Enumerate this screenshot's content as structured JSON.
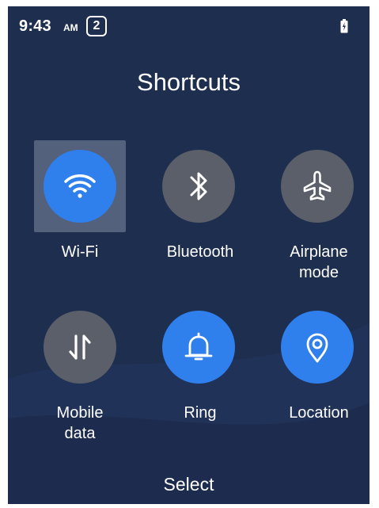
{
  "status_bar": {
    "time": "9:43",
    "ampm": "AM",
    "notification_count": "2",
    "battery_icon": "battery-charging-icon"
  },
  "screen": {
    "title": "Shortcuts"
  },
  "shortcuts": [
    {
      "label": "Wi-Fi",
      "icon": "wifi-icon",
      "state": "on",
      "focused": true
    },
    {
      "label": "Bluetooth",
      "icon": "bluetooth-icon",
      "state": "off",
      "focused": false
    },
    {
      "label": "Airplane\nmode",
      "icon": "airplane-icon",
      "state": "off",
      "focused": false
    },
    {
      "label": "Mobile\ndata",
      "icon": "mobile-data-icon",
      "state": "off",
      "focused": false
    },
    {
      "label": "Ring",
      "icon": "bell-icon",
      "state": "on",
      "focused": false
    },
    {
      "label": "Location",
      "icon": "location-pin-icon",
      "state": "on",
      "focused": false
    }
  ],
  "softkey": {
    "center": "Select"
  },
  "colors": {
    "background": "#1e2e4f",
    "active": "#2f80ed",
    "inactive": "#5a5f6a",
    "focus": "#8f98aa"
  }
}
